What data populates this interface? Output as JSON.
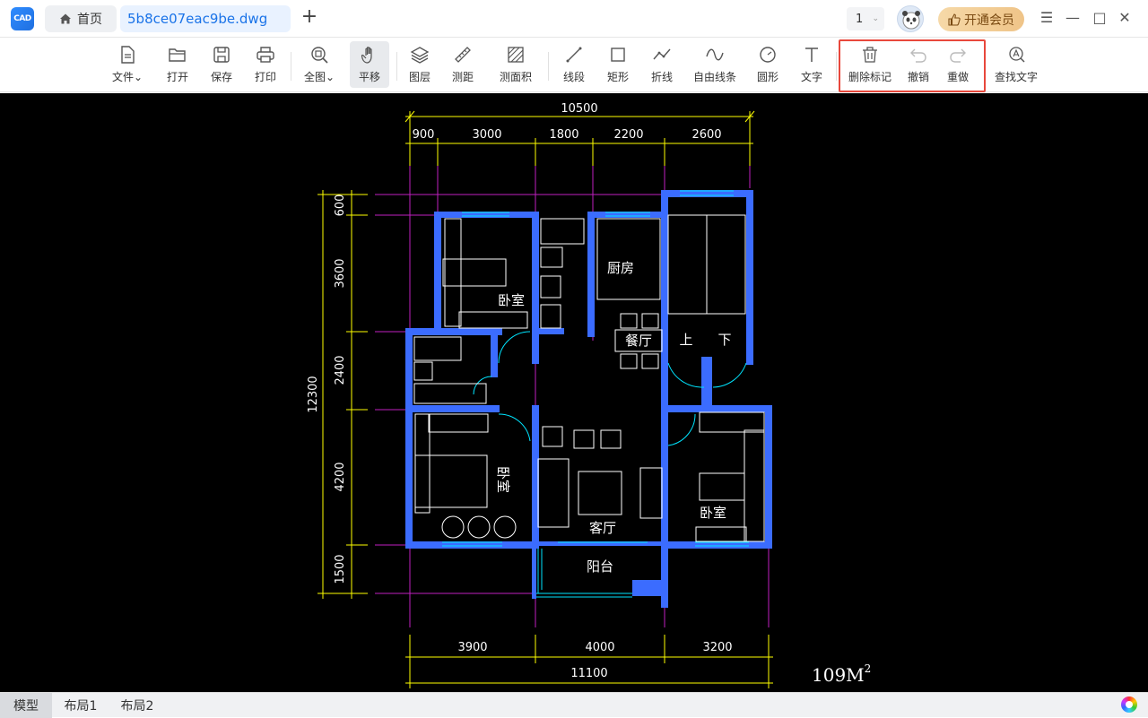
{
  "titlebar": {
    "logo_text": "CAD",
    "home_tab": "首页",
    "file_tab": "5b8ce07eac9be.dwg",
    "add_tab": "+",
    "page_select": "1",
    "vip_label": "开通会员"
  },
  "toolbar": {
    "items": [
      {
        "label": "文件",
        "icon": "file-icon"
      },
      {
        "label": "打开",
        "icon": "folder-open-icon"
      },
      {
        "label": "保存",
        "icon": "save-icon"
      },
      {
        "label": "打印",
        "icon": "printer-icon"
      },
      {
        "label": "全图",
        "icon": "zoom-extents-icon"
      },
      {
        "label": "平移",
        "icon": "hand-pan-icon"
      },
      {
        "label": "图层",
        "icon": "layers-icon"
      },
      {
        "label": "测距",
        "icon": "ruler-icon"
      },
      {
        "label": "测面积",
        "icon": "measure-area-icon"
      },
      {
        "label": "线段",
        "icon": "line-segment-icon"
      },
      {
        "label": "矩形",
        "icon": "rectangle-icon"
      },
      {
        "label": "折线",
        "icon": "polyline-icon"
      },
      {
        "label": "自由线条",
        "icon": "freehand-line-icon"
      },
      {
        "label": "圆形",
        "icon": "circle-icon"
      },
      {
        "label": "文字",
        "icon": "text-icon"
      },
      {
        "label": "删除标记",
        "icon": "trash-icon"
      },
      {
        "label": "撤销",
        "icon": "undo-icon"
      },
      {
        "label": "重做",
        "icon": "redo-icon"
      },
      {
        "label": "查找文字",
        "icon": "find-text-icon"
      }
    ]
  },
  "drawing": {
    "top_total": "10500",
    "top_dims": [
      "900",
      "3000",
      "1800",
      "2200",
      "2600"
    ],
    "left_total": "12300",
    "left_dims": [
      "600",
      "3600",
      "2400",
      "4200",
      "1500"
    ],
    "bottom_dims": [
      "3900",
      "4000",
      "3200"
    ],
    "bottom_total": "11100",
    "rooms": {
      "bedroom_top": "卧室",
      "kitchen": "厨房",
      "dining": "餐厅",
      "stair_up": "上",
      "stair_down": "下",
      "bedroom_left": "卧室",
      "living": "客厅",
      "bedroom_right": "卧室",
      "balcony": "阳台"
    },
    "area_label": "109M",
    "area_sup": "2"
  },
  "bottom_tabs": [
    "模型",
    "布局1",
    "布局2"
  ],
  "colors": {
    "accent": "#1a73e8",
    "wall": "#3b6cff",
    "dimension": "#ffff00",
    "axis": "#c020c0",
    "highlight": "#e8483c"
  }
}
